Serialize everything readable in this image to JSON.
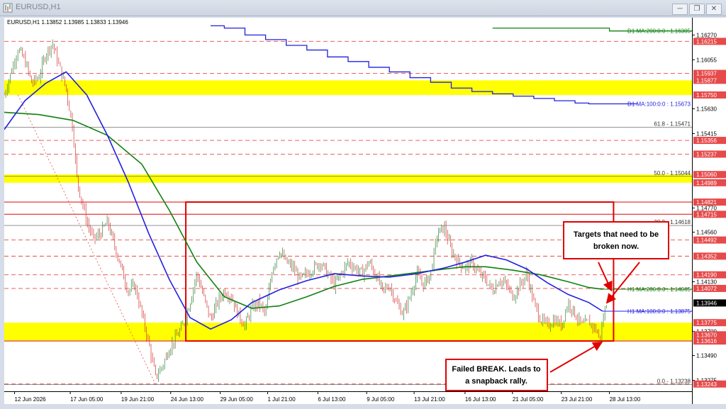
{
  "window": {
    "title": "EURUSD,H1",
    "controls": [
      "minimize",
      "restore",
      "close"
    ]
  },
  "chart_header": "EURUSD,H1  1.13852 1.13985 1.13833 1.13946",
  "colors": {
    "resistance_line": "#e64a4a",
    "box": "#e00000",
    "zone_fill": "#ffff00",
    "ma100": "#2020e0",
    "ma200": "#108010",
    "price_up": "#2e7d32",
    "price_down": "#d32f2f",
    "price_badge": "#000000"
  },
  "annotations": {
    "targets": {
      "line1": "Targets that need to be",
      "line2": "broken now."
    },
    "failed": {
      "line1": "Failed BREAK. Leads to",
      "line2": "a snapback rally."
    }
  },
  "chart_data": {
    "type": "candlestick",
    "symbol": "EURUSD",
    "timeframe": "H1",
    "ylim": [
      1.1318,
      1.1642
    ],
    "xlim": [
      0,
      100
    ],
    "x_ticks": [
      {
        "label": "12 Jun 2026",
        "x": 1.5
      },
      {
        "label": "17 Jun 05:00",
        "x": 9.6
      },
      {
        "label": "19 Jun 21:00",
        "x": 17.0
      },
      {
        "label": "24 Jun 13:00",
        "x": 24.2
      },
      {
        "label": "29 Jun 05:00",
        "x": 31.4
      },
      {
        "label": "1 Jul 21:00",
        "x": 38.3
      },
      {
        "label": "6 Jul 13:00",
        "x": 45.6
      },
      {
        "label": "9 Jul 05:00",
        "x": 52.7
      },
      {
        "label": "13 Jul 21:00",
        "x": 59.6
      },
      {
        "label": "16 Jul 13:00",
        "x": 67.0
      },
      {
        "label": "21 Jul 05:00",
        "x": 73.9
      },
      {
        "label": "23 Jul 21:00",
        "x": 81.0
      },
      {
        "label": "28 Jul 13:00",
        "x": 88.0
      }
    ],
    "y_ticks": [
      "1.16270",
      "1.16055",
      "1.15630",
      "1.15415",
      "1.14770",
      "1.14560",
      "1.14130",
      "1.13700",
      "1.13490",
      "1.13275"
    ],
    "highlighted_prices": [
      "1.16215",
      "1.15937",
      "1.15877",
      "1.15750",
      "1.15356",
      "1.15237",
      "1.15060",
      "1.14989",
      "1.14821",
      "1.14715",
      "1.14492",
      "1.14352",
      "1.14190",
      "1.14072",
      "1.13775",
      "1.13670",
      "1.13616",
      "1.13243"
    ],
    "current_price": "1.13946",
    "horizontal_lines": [
      {
        "price": 1.16215,
        "style": "dashed"
      },
      {
        "price": 1.15937,
        "style": "dashed"
      },
      {
        "price": 1.15356,
        "style": "dashed"
      },
      {
        "price": 1.15237,
        "style": "dashed"
      },
      {
        "price": 1.14821,
        "style": "solid"
      },
      {
        "price": 1.14715,
        "style": "solid"
      },
      {
        "price": 1.14492,
        "style": "dashed"
      },
      {
        "price": 1.14352,
        "style": "dashed"
      },
      {
        "price": 1.1419,
        "style": "dashed"
      },
      {
        "price": 1.14072,
        "style": "dashed"
      },
      {
        "price": 1.13616,
        "style": "solid"
      },
      {
        "price": 1.13243,
        "style": "dashed"
      }
    ],
    "zones": [
      {
        "from": 1.1575,
        "to": 1.15877
      },
      {
        "from": 1.14989,
        "to": 1.1506
      },
      {
        "from": 1.13616,
        "to": 1.13775
      }
    ],
    "box": {
      "x0": 26.4,
      "x1": 88.6,
      "y0": 1.13616,
      "y1": 1.14821
    },
    "fib_levels": [
      {
        "label": "61.8 - 1.15471",
        "price": 1.15471
      },
      {
        "label": "50.0 - 1.15044",
        "price": 1.15044
      },
      {
        "label": "38.2 - 1.14618",
        "price": 1.14618
      },
      {
        "label": "0.0 - 1.13238",
        "price": 1.13238
      }
    ],
    "ma_labels": [
      {
        "label": "D1 MA:200:0:0 : 1.16305",
        "price": 1.16305
      },
      {
        "label": "D1 MA:100:0:0 : 1.15673",
        "price": 1.15673
      },
      {
        "label": "H1 MA:200:0:0 : 1.14065",
        "price": 1.14065
      },
      {
        "label": "H1 MA:100:0:0 : 1.13875",
        "price": 1.13875
      }
    ],
    "d1_ma200": [
      [
        71,
        1.1633
      ],
      [
        88,
        1.16305
      ],
      [
        100,
        1.16305
      ]
    ],
    "d1_ma100": [
      [
        30,
        1.1635
      ],
      [
        32,
        1.1633
      ],
      [
        35,
        1.1627
      ],
      [
        38,
        1.1623
      ],
      [
        41,
        1.1618
      ],
      [
        44,
        1.1614
      ],
      [
        47,
        1.1608
      ],
      [
        50,
        1.1604
      ],
      [
        53,
        1.1599
      ],
      [
        56,
        1.1595
      ],
      [
        59,
        1.159
      ],
      [
        62,
        1.1586
      ],
      [
        65,
        1.1581
      ],
      [
        68,
        1.1578
      ],
      [
        71,
        1.1576
      ],
      [
        74,
        1.1574
      ],
      [
        77,
        1.1572
      ],
      [
        80,
        1.157
      ],
      [
        83,
        1.1568
      ],
      [
        85,
        1.15673
      ],
      [
        92,
        1.15673
      ]
    ],
    "h1_ma100": [
      [
        0,
        1.1545
      ],
      [
        3,
        1.157
      ],
      [
        6,
        1.1585
      ],
      [
        9,
        1.1595
      ],
      [
        12,
        1.1575
      ],
      [
        15,
        1.154
      ],
      [
        18,
        1.15
      ],
      [
        21,
        1.1455
      ],
      [
        24,
        1.1415
      ],
      [
        27,
        1.1382
      ],
      [
        30,
        1.1372
      ],
      [
        33,
        1.138
      ],
      [
        36,
        1.1395
      ],
      [
        40,
        1.1406
      ],
      [
        44,
        1.1414
      ],
      [
        48,
        1.142
      ],
      [
        52,
        1.1418
      ],
      [
        56,
        1.1417
      ],
      [
        60,
        1.142
      ],
      [
        64,
        1.1425
      ],
      [
        67,
        1.143
      ],
      [
        70,
        1.1436
      ],
      [
        73,
        1.1432
      ],
      [
        76,
        1.1424
      ],
      [
        79,
        1.1412
      ],
      [
        82,
        1.1402
      ],
      [
        85,
        1.1395
      ],
      [
        87,
        1.13875
      ]
    ],
    "h1_ma200": [
      [
        0,
        1.156
      ],
      [
        5,
        1.1558
      ],
      [
        10,
        1.1553
      ],
      [
        15,
        1.154
      ],
      [
        20,
        1.1515
      ],
      [
        24,
        1.1475
      ],
      [
        28,
        1.143
      ],
      [
        32,
        1.14
      ],
      [
        36,
        1.139
      ],
      [
        40,
        1.1392
      ],
      [
        44,
        1.14
      ],
      [
        48,
        1.1409
      ],
      [
        52,
        1.1415
      ],
      [
        56,
        1.1418
      ],
      [
        60,
        1.1421
      ],
      [
        64,
        1.1424
      ],
      [
        67,
        1.1426
      ],
      [
        70,
        1.1426
      ],
      [
        74,
        1.1423
      ],
      [
        78,
        1.1419
      ],
      [
        82,
        1.1413
      ],
      [
        85,
        1.1408
      ],
      [
        87,
        1.14065
      ]
    ],
    "price_path": [
      [
        0,
        1.1575
      ],
      [
        1,
        1.1595
      ],
      [
        2,
        1.1615
      ],
      [
        3,
        1.1605
      ],
      [
        4,
        1.1585
      ],
      [
        5,
        1.159
      ],
      [
        6,
        1.161
      ],
      [
        7,
        1.162
      ],
      [
        8,
        1.16
      ],
      [
        9,
        1.158
      ],
      [
        10,
        1.1545
      ],
      [
        10.5,
        1.1505
      ],
      [
        11,
        1.149
      ],
      [
        12,
        1.1465
      ],
      [
        13,
        1.145
      ],
      [
        14,
        1.1455
      ],
      [
        15,
        1.1465
      ],
      [
        16,
        1.1445
      ],
      [
        17,
        1.1425
      ],
      [
        18,
        1.1405
      ],
      [
        19,
        1.141
      ],
      [
        20,
        1.1385
      ],
      [
        21,
        1.136
      ],
      [
        22,
        1.133
      ],
      [
        23,
        1.134
      ],
      [
        24,
        1.1355
      ],
      [
        25,
        1.1365
      ],
      [
        26,
        1.1375
      ],
      [
        27,
        1.1395
      ],
      [
        28,
        1.142
      ],
      [
        29,
        1.14
      ],
      [
        30,
        1.138
      ],
      [
        31,
        1.1395
      ],
      [
        32,
        1.1405
      ],
      [
        33,
        1.14
      ],
      [
        34,
        1.1385
      ],
      [
        35,
        1.1375
      ],
      [
        36,
        1.139
      ],
      [
        37,
        1.1395
      ],
      [
        38,
        1.1385
      ],
      [
        39,
        1.1425
      ],
      [
        40,
        1.144
      ],
      [
        41,
        1.143
      ],
      [
        42,
        1.1425
      ],
      [
        43,
        1.1415
      ],
      [
        44,
        1.142
      ],
      [
        45,
        1.1425
      ],
      [
        46,
        1.143
      ],
      [
        47,
        1.142
      ],
      [
        48,
        1.141
      ],
      [
        49,
        1.142
      ],
      [
        50,
        1.143
      ],
      [
        51,
        1.1425
      ],
      [
        52,
        1.142
      ],
      [
        53,
        1.143
      ],
      [
        54,
        1.142
      ],
      [
        55,
        1.1405
      ],
      [
        56,
        1.141
      ],
      [
        57,
        1.1395
      ],
      [
        58,
        1.1385
      ],
      [
        59,
        1.14
      ],
      [
        60,
        1.142
      ],
      [
        61,
        1.141
      ],
      [
        62,
        1.142
      ],
      [
        63,
        1.1455
      ],
      [
        64,
        1.146
      ],
      [
        65,
        1.144
      ],
      [
        66,
        1.143
      ],
      [
        67,
        1.1425
      ],
      [
        68,
        1.143
      ],
      [
        69,
        1.142
      ],
      [
        70,
        1.1415
      ],
      [
        71,
        1.1405
      ],
      [
        72,
        1.1415
      ],
      [
        73,
        1.141
      ],
      [
        74,
        1.14
      ],
      [
        75,
        1.141
      ],
      [
        76,
        1.142
      ],
      [
        77,
        1.1395
      ],
      [
        78,
        1.138
      ],
      [
        79,
        1.1375
      ],
      [
        80,
        1.138
      ],
      [
        81,
        1.1375
      ],
      [
        82,
        1.1395
      ],
      [
        83,
        1.1385
      ],
      [
        84,
        1.1375
      ],
      [
        85,
        1.1378
      ],
      [
        86,
        1.1372
      ],
      [
        86.6,
        1.1363
      ],
      [
        87.2,
        1.1385
      ],
      [
        87.6,
        1.13946
      ]
    ]
  }
}
